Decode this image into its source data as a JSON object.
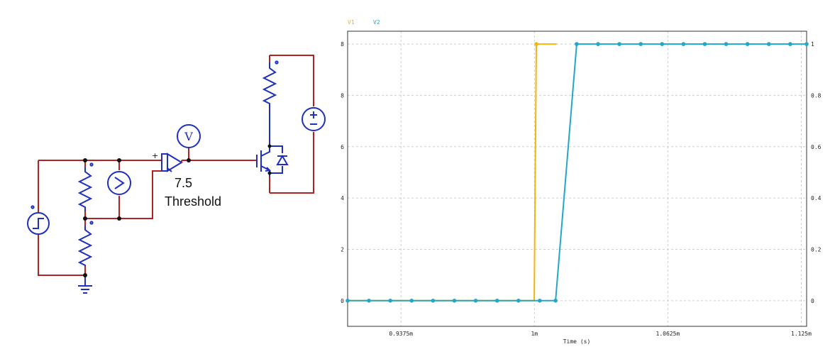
{
  "schematic": {
    "comparator_value": "7.5",
    "comparator_label": "Threshold",
    "comparator_plus": "+",
    "voltmeter_label": "V"
  },
  "chart_data": {
    "type": "line",
    "xlabel": "Time (s)",
    "xlim": [
      0.9125,
      1.1275
    ],
    "x_ticks": [
      0.9375,
      1.0,
      1.0625,
      1.125
    ],
    "x_tick_labels": [
      "0.9375m",
      "1m",
      "1.0625m",
      "1.125m"
    ],
    "left_ylim": [
      -1,
      10.5
    ],
    "left_ticks": [
      0,
      2,
      4,
      6,
      8,
      10
    ],
    "left_tick_labels": [
      "0",
      "2",
      "4",
      "6",
      "8",
      "8"
    ],
    "right_ylim": [
      -0.1,
      1.05
    ],
    "right_ticks": [
      0,
      0.2,
      0.4,
      0.6,
      0.8,
      1
    ],
    "right_tick_labels": [
      "0",
      "0.2",
      "0.4",
      "0.6",
      "0.8",
      "1"
    ],
    "grid": true,
    "legend_position": "top-left",
    "series": [
      {
        "name": "V1",
        "color": "#f5b40f",
        "axis": "left",
        "x": [
          0.9125,
          0.9999,
          1.0009,
          1.0104
        ],
        "y": [
          0,
          0,
          10,
          10
        ],
        "marker_x": [
          1.0009
        ],
        "marker_y": [
          10
        ]
      },
      {
        "name": "V2",
        "color": "#22a7c6",
        "axis": "right",
        "x": [
          0.9125,
          1.0099,
          1.0198,
          1.1275
        ],
        "y": [
          0,
          0,
          1,
          1
        ],
        "marker_x": [
          0.9125,
          0.9225,
          0.9325,
          0.9425,
          0.9525,
          0.9625,
          0.9725,
          0.9825,
          0.9925,
          1.0025,
          1.0099,
          1.0198,
          1.0298,
          1.0398,
          1.0498,
          1.0598,
          1.0698,
          1.0798,
          1.0898,
          1.0998,
          1.1098,
          1.1198,
          1.1275
        ],
        "marker_y": [
          0,
          0,
          0,
          0,
          0,
          0,
          0,
          0,
          0,
          0,
          0,
          1,
          1,
          1,
          1,
          1,
          1,
          1,
          1,
          1,
          1,
          1,
          1
        ]
      }
    ]
  }
}
